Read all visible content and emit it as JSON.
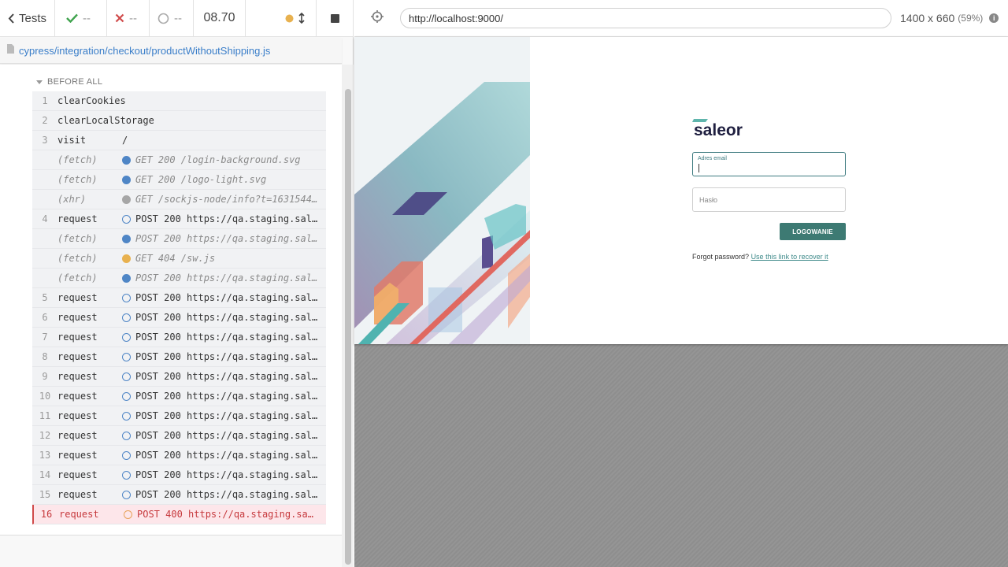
{
  "reporter": {
    "tests_label": "Tests",
    "passed": "--",
    "failed": "--",
    "pending": "--",
    "duration": "08.70",
    "spec_path": "cypress/integration/checkout/productWithoutShipping.js",
    "hook_title": "BEFORE ALL",
    "commands": [
      {
        "num": "1",
        "name": "clearCookies",
        "message": "",
        "type": "command",
        "dot": ""
      },
      {
        "num": "2",
        "name": "clearLocalStorage",
        "message": "",
        "type": "command",
        "dot": ""
      },
      {
        "num": "3",
        "name": "visit",
        "message": "/",
        "type": "command",
        "dot": ""
      },
      {
        "num": "",
        "name": "(fetch)",
        "message": "GET 200 /login-background.svg",
        "type": "event",
        "dot": "blue"
      },
      {
        "num": "",
        "name": "(fetch)",
        "message": "GET 200 /logo-light.svg",
        "type": "event",
        "dot": "blue"
      },
      {
        "num": "",
        "name": "(xhr)",
        "message": "GET /sockjs-node/info?t=1631544…",
        "type": "event",
        "dot": "gray"
      },
      {
        "num": "4",
        "name": "request",
        "message": "POST 200 https://qa.staging.sal…",
        "type": "command",
        "dot": "ring-blue"
      },
      {
        "num": "",
        "name": "(fetch)",
        "message": "POST 200 https://qa.staging.sal…",
        "type": "event",
        "dot": "blue"
      },
      {
        "num": "",
        "name": "(fetch)",
        "message": "GET 404 /sw.js",
        "type": "event",
        "dot": "orange"
      },
      {
        "num": "",
        "name": "(fetch)",
        "message": "POST 200 https://qa.staging.sal…",
        "type": "event",
        "dot": "blue"
      },
      {
        "num": "5",
        "name": "request",
        "message": "POST 200 https://qa.staging.sal…",
        "type": "command",
        "dot": "ring-blue"
      },
      {
        "num": "6",
        "name": "request",
        "message": "POST 200 https://qa.staging.sal…",
        "type": "command",
        "dot": "ring-blue"
      },
      {
        "num": "7",
        "name": "request",
        "message": "POST 200 https://qa.staging.sal…",
        "type": "command",
        "dot": "ring-blue"
      },
      {
        "num": "8",
        "name": "request",
        "message": "POST 200 https://qa.staging.sal…",
        "type": "command",
        "dot": "ring-blue"
      },
      {
        "num": "9",
        "name": "request",
        "message": "POST 200 https://qa.staging.sal…",
        "type": "command",
        "dot": "ring-blue"
      },
      {
        "num": "10",
        "name": "request",
        "message": "POST 200 https://qa.staging.sal…",
        "type": "command",
        "dot": "ring-blue"
      },
      {
        "num": "11",
        "name": "request",
        "message": "POST 200 https://qa.staging.sal…",
        "type": "command",
        "dot": "ring-blue"
      },
      {
        "num": "12",
        "name": "request",
        "message": "POST 200 https://qa.staging.sal…",
        "type": "command",
        "dot": "ring-blue"
      },
      {
        "num": "13",
        "name": "request",
        "message": "POST 200 https://qa.staging.sal…",
        "type": "command",
        "dot": "ring-blue"
      },
      {
        "num": "14",
        "name": "request",
        "message": "POST 200 https://qa.staging.sal…",
        "type": "command",
        "dot": "ring-blue"
      },
      {
        "num": "15",
        "name": "request",
        "message": "POST 200 https://qa.staging.sal…",
        "type": "command",
        "dot": "ring-blue"
      },
      {
        "num": "16",
        "name": "request",
        "message": "POST 400 https://qa.staging.sal…",
        "type": "failed",
        "dot": "ring-orange"
      }
    ]
  },
  "aut": {
    "url": "http://localhost:9000/",
    "viewport": "1400 x 660",
    "scale": "(59%)",
    "info_icon": "i"
  },
  "login": {
    "logo_text": "saleor",
    "email_label": "Adres email",
    "password_label": "Hasło",
    "login_button": "LOGOWANIE",
    "forgot_text": "Forgot password?",
    "forgot_link": "Use this link to recover it"
  },
  "colors": {
    "accent_teal": "#3d7a73",
    "link_blue": "#3a7ec9",
    "pass_green": "#3fa34d",
    "fail_red": "#d04a4a",
    "running_orange": "#e8b14f"
  },
  "icons": {
    "tests_back": "chevron-left-icon",
    "passed": "check-icon",
    "failed": "x-icon",
    "pending": "circle-notch-icon",
    "running": "dot-icon",
    "scroll": "arrows-vertical-icon",
    "stop": "stop-icon",
    "selector": "crosshair-icon",
    "spec_file": "file-icon"
  }
}
